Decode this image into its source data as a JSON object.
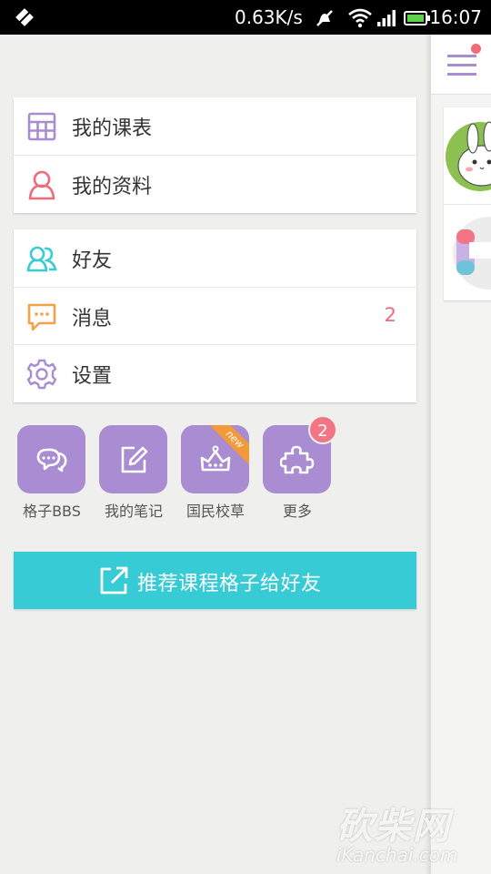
{
  "status_bar": {
    "speed": "0.63K/s",
    "time": "16:07"
  },
  "menu_group_1": [
    {
      "label": "我的课表",
      "icon": "timetable-icon",
      "color": "#a98cd1"
    },
    {
      "label": "我的资料",
      "icon": "profile-icon",
      "color": "#f06a7a"
    }
  ],
  "menu_group_2": [
    {
      "label": "好友",
      "icon": "friends-icon",
      "color": "#37cbd6"
    },
    {
      "label": "消息",
      "icon": "message-icon",
      "color": "#f3a24a",
      "badge": "2"
    },
    {
      "label": "设置",
      "icon": "settings-icon",
      "color": "#a98cd1"
    }
  ],
  "grid_items": [
    {
      "label": "格子BBS",
      "icon": "chat-bubbles-icon"
    },
    {
      "label": "我的笔记",
      "icon": "note-edit-icon"
    },
    {
      "label": "国民校草",
      "icon": "crown-icon",
      "ribbon": "new"
    },
    {
      "label": "更多",
      "icon": "puzzle-icon",
      "badge": "2"
    }
  ],
  "share_button": {
    "label": "推荐课程格子给好友",
    "icon": "share-external-icon"
  },
  "watermark": {
    "title": "砍柴网",
    "url": "iKanchai.com"
  },
  "colors": {
    "accent_purple": "#a98cd1",
    "accent_cyan": "#37cbd6",
    "badge_red": "#f06a7a"
  }
}
